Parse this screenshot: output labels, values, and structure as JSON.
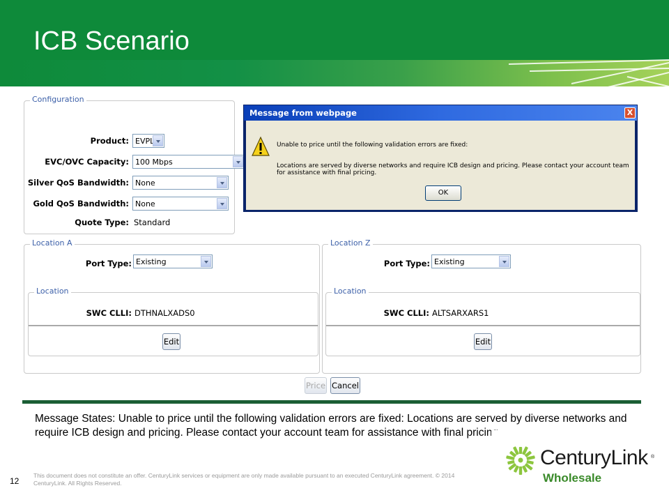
{
  "slide": {
    "title": "ICB Scenario",
    "page_number": "12",
    "message_statement": "Message States: Unable to price until the following validation errors are fixed: Locations are served by diverse networks and require ICB design and pricing.  Please contact your account team for assistance with final pricing",
    "disclaimer": "This document does not constitute an offer.  CenturyLink services or equipment are only made available pursuant to an executed CenturyLink agreement. © 2014 CenturyLink. All Rights Reserved."
  },
  "configuration": {
    "legend": "Configuration",
    "product": {
      "label": "Product:",
      "value": "EVPL"
    },
    "capacity": {
      "label": "EVC/OVC Capacity:",
      "value": "100 Mbps"
    },
    "silver_qos": {
      "label": "Silver QoS Bandwidth:",
      "value": "None"
    },
    "gold_qos": {
      "label": "Gold QoS Bandwidth:",
      "value": "None"
    },
    "quote_type": {
      "label": "Quote Type:",
      "value": "Standard"
    }
  },
  "location_a": {
    "legend": "Location A",
    "port_type": {
      "label": "Port Type:",
      "value": "Existing"
    },
    "location_legend": "Location",
    "swc_clli": {
      "label": "SWC CLLI:",
      "value": "DTHNALXADS0"
    },
    "edit_label": "Edit"
  },
  "location_z": {
    "legend": "Location Z",
    "port_type": {
      "label": "Port Type:",
      "value": "Existing"
    },
    "location_legend": "Location",
    "swc_clli": {
      "label": "SWC CLLI:",
      "value": "ALTSARXARS1"
    },
    "edit_label": "Edit"
  },
  "actions": {
    "price_label": "Price",
    "cancel_label": "Cancel"
  },
  "dialog": {
    "title": "Message from webpage",
    "close_glyph": "X",
    "line1": "Unable to price until the following validation errors are fixed:",
    "line2": "Locations are served by diverse networks and require ICB design and pricing. Please contact your account team for assistance with final pricing.",
    "ok_label": "OK",
    "icon": "warning-icon"
  },
  "logo": {
    "brand": "CenturyLink",
    "registered": "®",
    "sub": "Wholesale"
  },
  "colors": {
    "header_green": "#0e8a3a",
    "logo_green": "#3a8a2a",
    "dialog_title": "#0a3fb8",
    "divider": "#1b5e35"
  }
}
